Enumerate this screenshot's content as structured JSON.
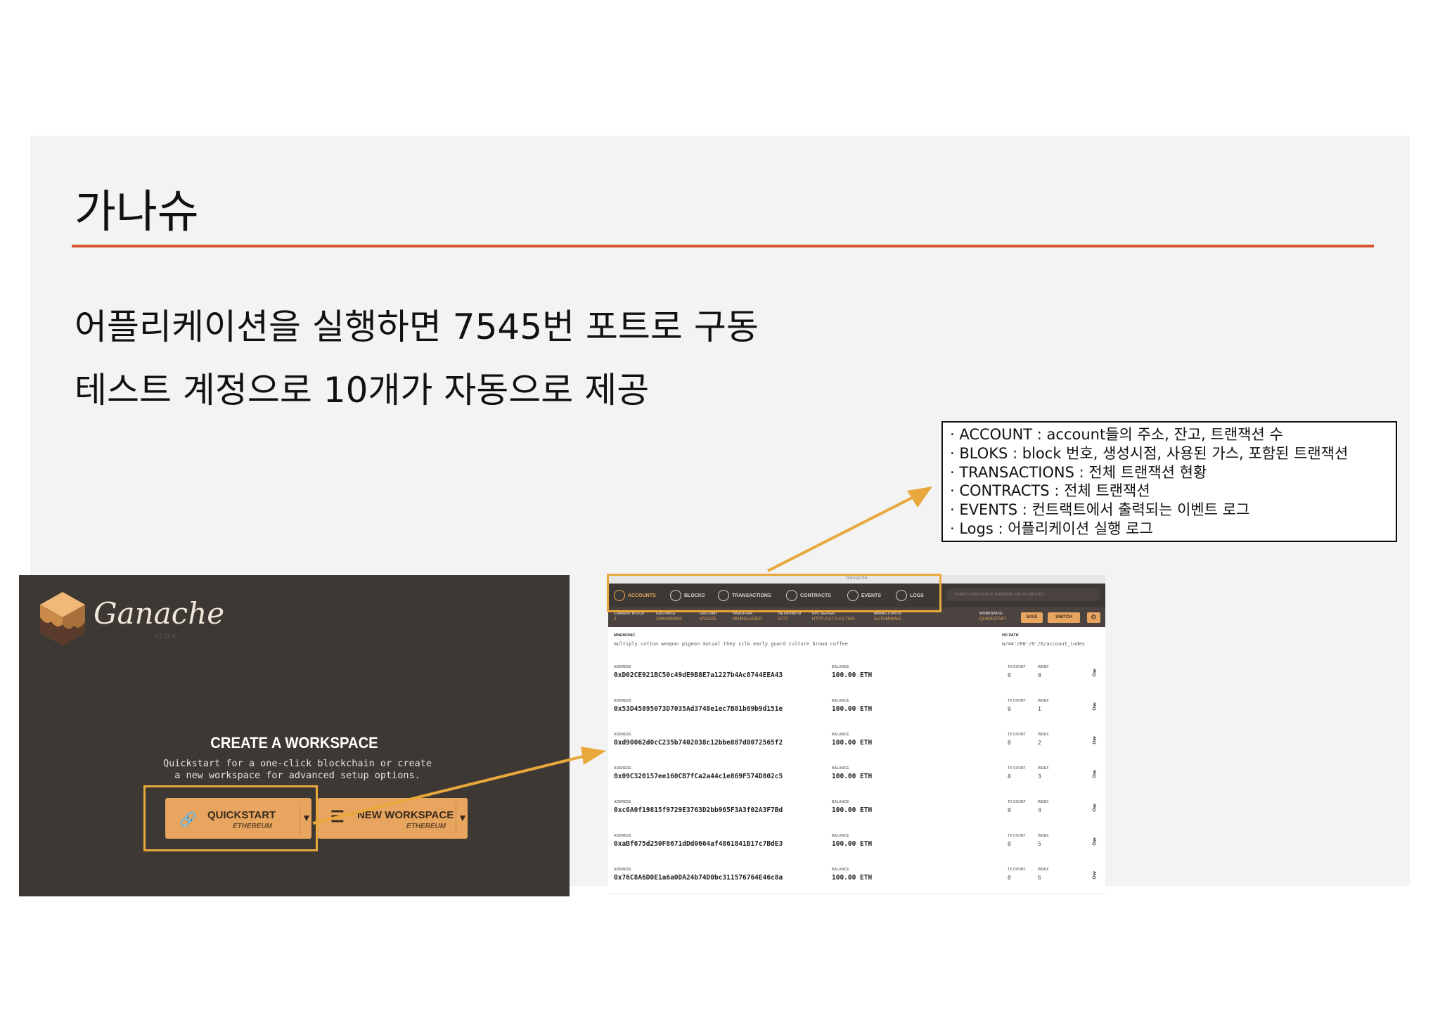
{
  "slide": {
    "title": "가나슈",
    "bullets": [
      "어플리케이션을 실행하면 7545번 포트로 구동",
      "테스트 계정으로 10개가 자동으로 제공"
    ],
    "info_lines": [
      "· ACCOUNT : account들의 주소, 잔고, 트랜잭션 수",
      "· BLOKS : block 번호, 생성시점, 사용된 가스, 포함된 트랜잭션",
      "· TRANSACTIONS : 전체 트랜잭션 현황",
      "· CONTRACTS : 전체 트랜잭션",
      "· EVENTS : 컨트랙트에서 출력되는 이벤트 로그",
      "· Logs : 어플리케이션 실행 로그"
    ],
    "colors": {
      "title_rule": "#d8542f",
      "highlight": "#e8a83b",
      "app_dark": "#3e3834",
      "accent": "#e7a55f"
    }
  },
  "welcome": {
    "logo_text": "Ganache",
    "version": "v2.0.4",
    "heading": "CREATE A WORKSPACE",
    "description_lines": [
      "Quickstart for a one-click blockchain or create",
      "a new workspace for advanced setup options."
    ],
    "quickstart": {
      "label": "QUICKSTART",
      "sub": "ETHEREUM",
      "icon": "link-icon"
    },
    "new_workspace": {
      "label": "NEW WORKSPACE",
      "sub": "ETHEREUM",
      "icon": "list-icon"
    },
    "dropdown_glyph": "▼"
  },
  "app": {
    "window_title": "Ganache",
    "nav": [
      {
        "label": "ACCOUNTS",
        "icon": "accounts-icon"
      },
      {
        "label": "BLOCKS",
        "icon": "blocks-icon"
      },
      {
        "label": "TRANSACTIONS",
        "icon": "transactions-icon"
      },
      {
        "label": "CONTRACTS",
        "icon": "contracts-icon"
      },
      {
        "label": "EVENTS",
        "icon": "events-icon"
      },
      {
        "label": "LOGS",
        "icon": "logs-icon"
      }
    ],
    "search_placeholder": "SEARCH FOR BLOCK NUMBERS OR TX HASHES",
    "stats": [
      {
        "label": "CURRENT BLOCK",
        "value": "0"
      },
      {
        "label": "GAS PRICE",
        "value": "20000000000"
      },
      {
        "label": "GAS LIMIT",
        "value": "6721975"
      },
      {
        "label": "HARDFORK",
        "value": "MUIRGLACIER"
      },
      {
        "label": "NETWORK ID",
        "value": "5777"
      },
      {
        "label": "RPC SERVER",
        "value": "HTTP://127.0.0.1:7545"
      },
      {
        "label": "MINING STATUS",
        "value": "AUTOMINING"
      },
      {
        "label": "WORKSPACE",
        "value": "QUICKSTART"
      }
    ],
    "save_label": "SAVE",
    "switch_label": "SWITCH",
    "mnemonic_label": "MNEMONIC",
    "mnemonic": "multiply cotton weapon pigeon mutual they silk early guard culture brown coffee",
    "hd_path_label": "HD PATH",
    "hd_path": "m/44'/60'/0'/0/account_index",
    "col_labels": {
      "address": "ADDRESS",
      "balance": "BALANCE",
      "tx_count": "TX COUNT",
      "index": "INDEX"
    },
    "accounts": [
      {
        "address": "0xD02CE921BC50c49dE9B8E7a1227b4Ac8744EEA43",
        "balance": "100.00 ETH",
        "tx_count": "0",
        "index": "0"
      },
      {
        "address": "0x53D45895073D7035Ad3748e1ec7B81b89b9d151e",
        "balance": "100.00 ETH",
        "tx_count": "0",
        "index": "1"
      },
      {
        "address": "0xd90062d0cC235b7402038c12bbe887d0072565f2",
        "balance": "100.00 ETH",
        "tx_count": "0",
        "index": "2"
      },
      {
        "address": "0x09C320157ee160CB7fCa2a44c1e869F574D802c5",
        "balance": "100.00 ETH",
        "tx_count": "0",
        "index": "3"
      },
      {
        "address": "0xc6A0f19815f9729E3763D2bb965F3A3f02A3F7Bd",
        "balance": "100.00 ETH",
        "tx_count": "0",
        "index": "4"
      },
      {
        "address": "0xaBf675d250F8671dDd0664af4861841B17c7BdE3",
        "balance": "100.00 ETH",
        "tx_count": "0",
        "index": "5"
      },
      {
        "address": "0x76C8A6D0E1a6a0DA24b74D0bc311576764E46c8a",
        "balance": "100.00 ETH",
        "tx_count": "0",
        "index": "6"
      }
    ]
  }
}
